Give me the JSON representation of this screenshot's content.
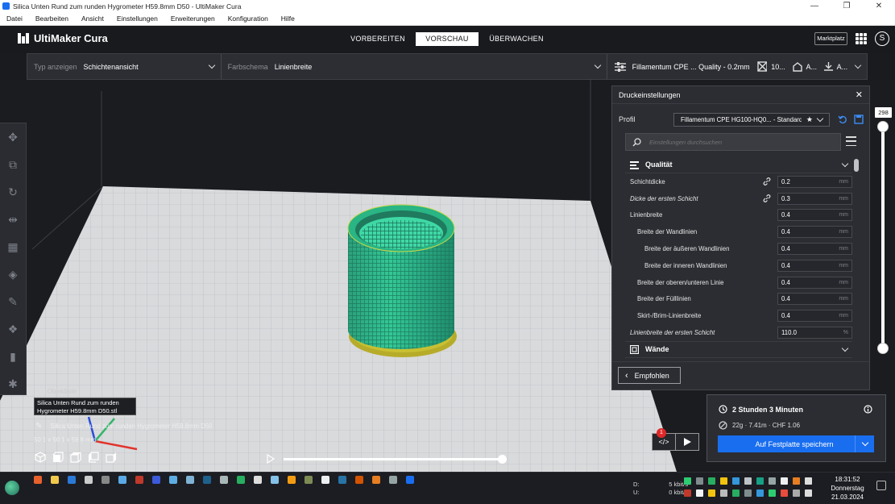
{
  "window": {
    "title": "Silica Unten Rund zum runden Hygrometer H59.8mm D50 - UltiMaker Cura",
    "controls": [
      "—",
      "❐",
      "✕"
    ]
  },
  "menu": [
    "Datei",
    "Bearbeiten",
    "Ansicht",
    "Einstellungen",
    "Erweiterungen",
    "Konfiguration",
    "Hilfe"
  ],
  "header": {
    "logo": "UltiMaker Cura",
    "stages": [
      "VORBEREITEN",
      "VORSCHAU",
      "ÜBERWACHEN"
    ],
    "active_stage": "VORSCHAU",
    "marketplace": "Marktplatz",
    "avatar_letter": "S"
  },
  "toolbar": {
    "view_type_label": "Typ anzeigen",
    "view_type_value": "Schichtenansicht",
    "color_scheme_label": "Farbschema",
    "color_scheme_value": "Linienbreite",
    "print_setup": "Fillamentum CPE ... Quality - 0.2mm",
    "support": "10...",
    "adhesion": "A...",
    "extra": "A..."
  },
  "print_settings": {
    "title": "Druckeinstellungen",
    "profile_label": "Profil",
    "profile_value": "Fillamentum CPE HG100-HQ0... - Standard ...",
    "search_placeholder": "Einstellungen durchsuchen",
    "categories": [
      {
        "name": "Qualität",
        "expanded": true,
        "settings": [
          {
            "label": "Schichtdicke",
            "value": "0.2",
            "unit": "mm",
            "indent": 0,
            "italic": false,
            "linked": true
          },
          {
            "label": "Dicke der ersten Schicht",
            "value": "0.3",
            "unit": "mm",
            "indent": 0,
            "italic": true,
            "linked": true
          },
          {
            "label": "Linienbreite",
            "value": "0.4",
            "unit": "mm",
            "indent": 0,
            "italic": false,
            "linked": false
          },
          {
            "label": "Breite der Wandlinien",
            "value": "0.4",
            "unit": "mm",
            "indent": 1,
            "italic": false,
            "linked": false
          },
          {
            "label": "Breite der äußeren Wandlinien",
            "value": "0.4",
            "unit": "mm",
            "indent": 2,
            "italic": false,
            "linked": false
          },
          {
            "label": "Breite der inneren Wandlinien",
            "value": "0.4",
            "unit": "mm",
            "indent": 2,
            "italic": false,
            "linked": false
          },
          {
            "label": "Breite der oberen/unteren Linie",
            "value": "0.4",
            "unit": "mm",
            "indent": 1,
            "italic": false,
            "linked": false
          },
          {
            "label": "Breite der Fülllinien",
            "value": "0.4",
            "unit": "mm",
            "indent": 1,
            "italic": false,
            "linked": false
          },
          {
            "label": "Skirt-/Brim-Linienbreite",
            "value": "0.4",
            "unit": "mm",
            "indent": 1,
            "italic": false,
            "linked": false
          },
          {
            "label": "Linienbreite der ersten Schicht",
            "value": "110.0",
            "unit": "%",
            "indent": 0,
            "italic": true,
            "linked": false
          }
        ]
      },
      {
        "name": "Wände",
        "expanded": false,
        "settings": []
      }
    ],
    "recommended_button": "Empfohlen"
  },
  "layer_slider": {
    "max_layer": "298",
    "top_fraction": 1.0,
    "bottom_fraction": 0.0
  },
  "object_list": {
    "title": "Objektliste",
    "tooltip": "Silica Unten Rund zum runden Hygrometer H59.8mm D50.stl",
    "object_name": "Silica Unten Rund zum runden Hygrometer H59.8mm D50",
    "dimensions": "50.1 x 50.1 x 59.8 mm"
  },
  "simulation": {
    "progress": 0.99
  },
  "actions": {
    "badge": "1"
  },
  "output": {
    "print_time": "2 Stunden 3 Minuten",
    "material": "22g · 7.41m · CHF 1.06",
    "save_button": "Auf Festplatte speichern"
  },
  "taskbar": {
    "net_down_label": "D:",
    "net_down": "5 kbit/s",
    "net_up_label": "U:",
    "net_up": "0 kbit/s",
    "time": "18:31:52",
    "day": "Donnerstag",
    "date": "21.03.2024"
  },
  "colors": {
    "accent": "#196ef0",
    "model": "#1fbf8a",
    "brim": "#c8c032",
    "panel": "#2b2d32",
    "background": "#1b1c20"
  }
}
